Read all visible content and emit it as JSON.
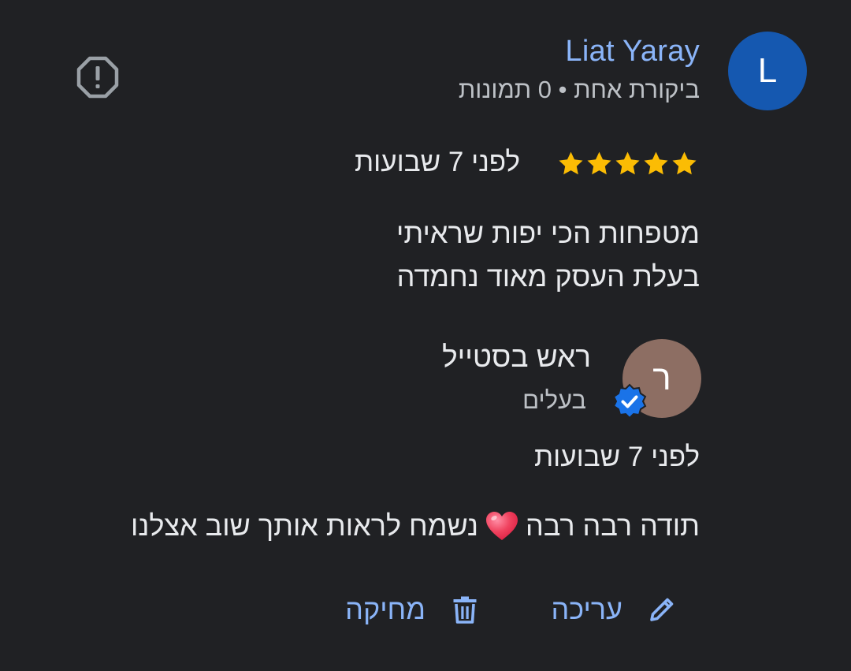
{
  "reviewer": {
    "name": "Liat Yaray",
    "initial": "L",
    "meta": "ביקורת אחת • 0 תמונות",
    "avatar_color": "#1558b0"
  },
  "review": {
    "rating": 5,
    "rating_max": 5,
    "time": "לפני 7 שבועות",
    "text_line1": "מטפחות הכי יפות שראיתי",
    "text_line2": "בעלת העסק מאוד נחמדה"
  },
  "owner_reply": {
    "initial": "ר",
    "name": "ראש בסטייל",
    "role": "בעלים",
    "time": "לפני 7 שבועות",
    "text_before_heart": "תודה רבה רבה",
    "text_after_heart": "נשמח לראות אותך שוב אצלנו",
    "avatar_color": "#8d6e63"
  },
  "actions": {
    "edit_label": "עריכה",
    "delete_label": "מחיקה"
  },
  "icons": {
    "report": "report-octagon-icon",
    "star": "star-icon",
    "verified": "verified-badge-icon",
    "heart": "heart-emoji-icon",
    "edit": "pencil-icon",
    "delete": "trash-icon"
  },
  "colors": {
    "background": "#202124",
    "link": "#8ab4f8",
    "star": "#fbbc04",
    "verified": "#1a73e8"
  }
}
